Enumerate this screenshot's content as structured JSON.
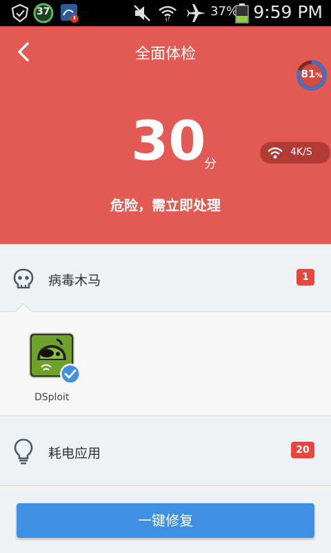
{
  "status_bar": {
    "notification_count": "37",
    "battery_percent": "37%",
    "time": "9:59 PM",
    "icons": [
      "shield-app-icon",
      "counter-badge-icon",
      "sync-alert-icon",
      "mute-icon",
      "wifi-icon",
      "airplane-icon",
      "battery-icon"
    ]
  },
  "header": {
    "title": "全面体检",
    "gauge_value": "81",
    "gauge_unit": "%",
    "gauge_level": 0.81,
    "score": "30",
    "score_unit": "分",
    "speed": "4K/S",
    "status": "危险，需立即处理",
    "color": "#e25a53"
  },
  "sections": [
    {
      "label": "病毒木马",
      "badge": "1",
      "icon": "skull-icon"
    },
    {
      "label": "耗电应用",
      "badge": "20",
      "icon": "lightbulb-icon"
    }
  ],
  "apps": [
    {
      "name": "DSploit",
      "selected": true
    }
  ],
  "action": {
    "fix_label": "一键修复",
    "color": "#3f8fe3"
  }
}
